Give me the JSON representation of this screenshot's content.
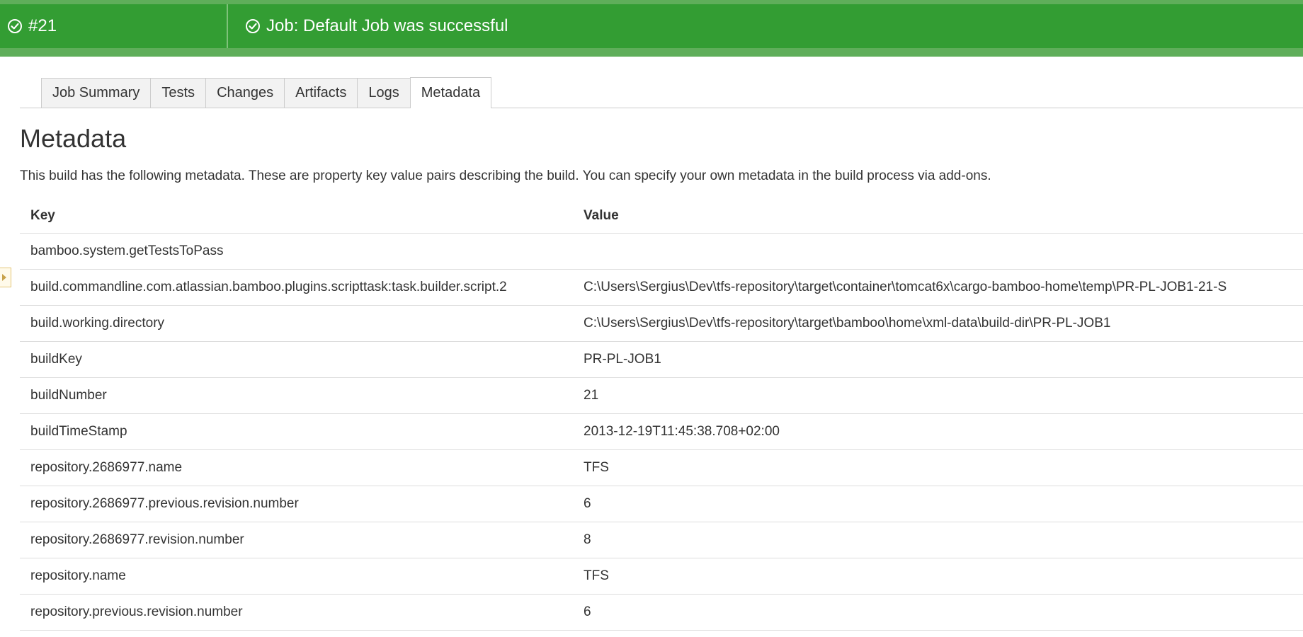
{
  "status": {
    "build_number": "#21",
    "job_message": "Job: Default Job was successful"
  },
  "tabs": [
    {
      "label": "Job Summary"
    },
    {
      "label": "Tests"
    },
    {
      "label": "Changes"
    },
    {
      "label": "Artifacts"
    },
    {
      "label": "Logs"
    },
    {
      "label": "Metadata"
    }
  ],
  "page": {
    "title": "Metadata",
    "description": "This build has the following metadata. These are property key value pairs describing the build. You can specify your own metadata in the build process via add-ons."
  },
  "table": {
    "headers": {
      "key": "Key",
      "value": "Value"
    },
    "rows": [
      {
        "key": "bamboo.system.getTestsToPass",
        "value": ""
      },
      {
        "key": "build.commandline.com.atlassian.bamboo.plugins.scripttask:task.builder.script.2",
        "value": "C:\\Users\\Sergius\\Dev\\tfs-repository\\target\\container\\tomcat6x\\cargo-bamboo-home\\temp\\PR-PL-JOB1-21-S"
      },
      {
        "key": "build.working.directory",
        "value": "C:\\Users\\Sergius\\Dev\\tfs-repository\\target\\bamboo\\home\\xml-data\\build-dir\\PR-PL-JOB1"
      },
      {
        "key": "buildKey",
        "value": "PR-PL-JOB1"
      },
      {
        "key": "buildNumber",
        "value": "21"
      },
      {
        "key": "buildTimeStamp",
        "value": "2013-12-19T11:45:38.708+02:00"
      },
      {
        "key": "repository.2686977.name",
        "value": "TFS"
      },
      {
        "key": "repository.2686977.previous.revision.number",
        "value": "6"
      },
      {
        "key": "repository.2686977.revision.number",
        "value": "8"
      },
      {
        "key": "repository.name",
        "value": "TFS"
      },
      {
        "key": "repository.previous.revision.number",
        "value": "6"
      }
    ]
  },
  "colors": {
    "status_green": "#339d33",
    "status_green_light": "#5fae5a"
  },
  "icons": {
    "status": "check-circle-icon",
    "side_handle": "expand-arrow-icon"
  }
}
